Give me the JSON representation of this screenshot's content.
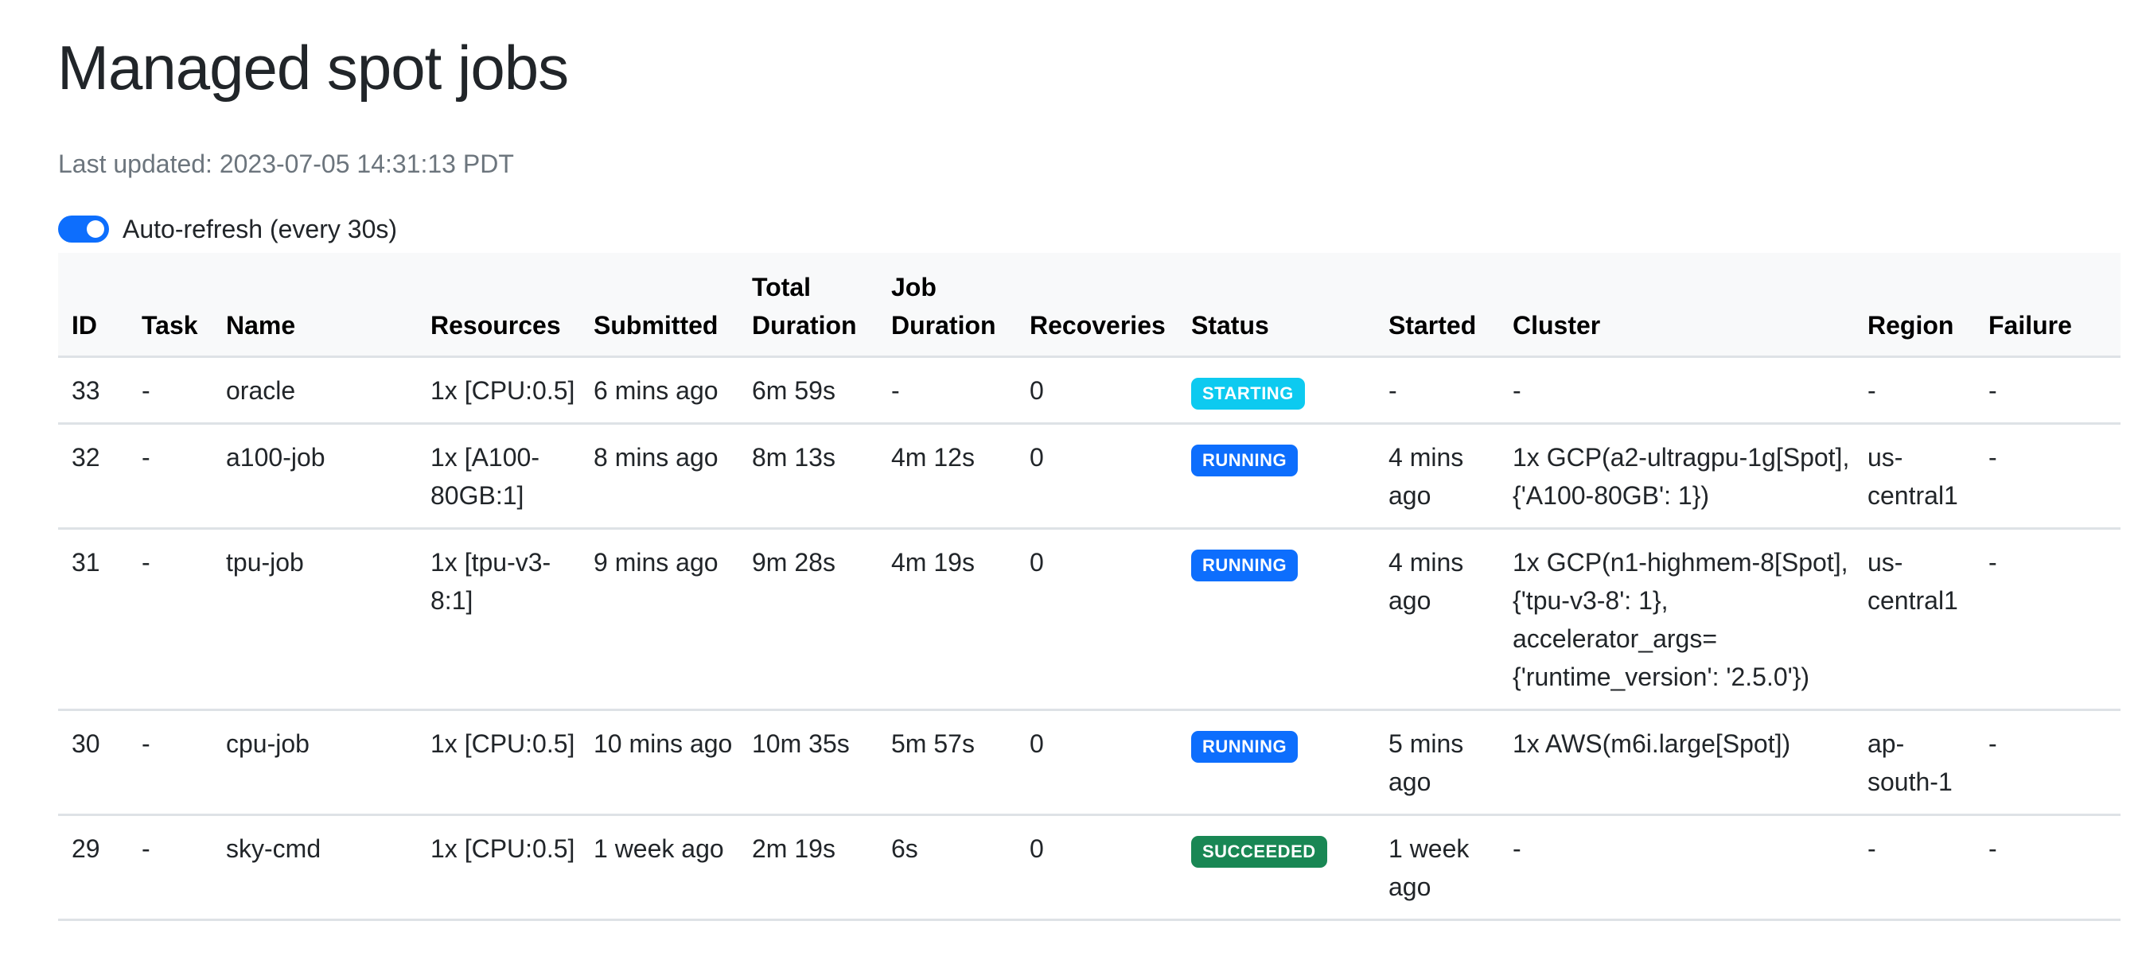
{
  "page": {
    "title": "Managed spot jobs",
    "last_updated": "Last updated: 2023-07-05 14:31:13 PDT",
    "auto_refresh": {
      "label": "Auto-refresh (every 30s)",
      "enabled": true,
      "toggle_color": "#0d6efd"
    }
  },
  "table": {
    "headers": [
      "ID",
      "Task",
      "Name",
      "Resources",
      "Submitted",
      "Total Duration",
      "Job Duration",
      "Recoveries",
      "Status",
      "Started",
      "Cluster",
      "Region",
      "Failure"
    ],
    "rows": [
      {
        "id": "33",
        "task": "-",
        "name": "oracle",
        "resources": "1x [CPU:0.5]",
        "submitted": "6 mins ago",
        "total_duration": "6m 59s",
        "job_duration": "-",
        "recoveries": "0",
        "status": "STARTING",
        "started": "-",
        "cluster": "-",
        "region": "-",
        "failure": "-"
      },
      {
        "id": "32",
        "task": "-",
        "name": "a100-job",
        "resources": "1x [A100-80GB:1]",
        "submitted": "8 mins ago",
        "total_duration": "8m 13s",
        "job_duration": "4m 12s",
        "recoveries": "0",
        "status": "RUNNING",
        "started": "4 mins ago",
        "cluster": "1x GCP(a2-ultragpu-1g[Spot], {'A100-80GB': 1})",
        "region": "us-central1",
        "failure": "-"
      },
      {
        "id": "31",
        "task": "-",
        "name": "tpu-job",
        "resources": "1x [tpu-v3-8:1]",
        "submitted": "9 mins ago",
        "total_duration": "9m 28s",
        "job_duration": "4m 19s",
        "recoveries": "0",
        "status": "RUNNING",
        "started": "4 mins ago",
        "cluster": "1x GCP(n1-highmem-8[Spot], {'tpu-v3-8': 1}, accelerator_args={'runtime_version': '2.5.0'})",
        "region": "us-central1",
        "failure": "-"
      },
      {
        "id": "30",
        "task": "-",
        "name": "cpu-job",
        "resources": "1x [CPU:0.5]",
        "submitted": "10 mins ago",
        "total_duration": "10m 35s",
        "job_duration": "5m 57s",
        "recoveries": "0",
        "status": "RUNNING",
        "started": "5 mins ago",
        "cluster": "1x AWS(m6i.large[Spot])",
        "region": "ap-south-1",
        "failure": "-"
      },
      {
        "id": "29",
        "task": "-",
        "name": "sky-cmd",
        "resources": "1x [CPU:0.5]",
        "submitted": "1 week ago",
        "total_duration": "2m 19s",
        "job_duration": "6s",
        "recoveries": "0",
        "status": "SUCCEEDED",
        "started": "1 week ago",
        "cluster": "-",
        "region": "-",
        "failure": "-"
      }
    ]
  },
  "status_colors": {
    "STARTING": "#0dcaf0",
    "RUNNING": "#0d6efd",
    "SUCCEEDED": "#198754"
  }
}
